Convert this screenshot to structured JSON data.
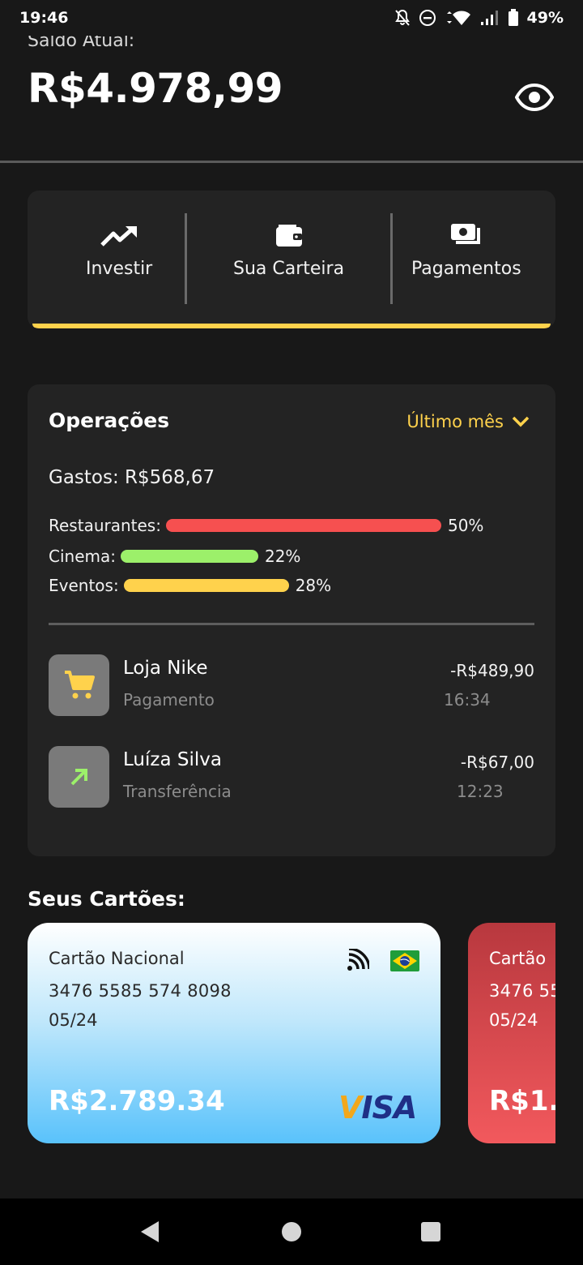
{
  "status_bar": {
    "time": "19:46",
    "battery": "49%"
  },
  "header": {
    "balance_label": "Saldo Atual:",
    "balance_value": "R$4.978,99"
  },
  "quick_actions": [
    {
      "label": "Investir",
      "icon": "trending-up-icon"
    },
    {
      "label": "Sua Carteira",
      "icon": "wallet-icon"
    },
    {
      "label": "Pagamentos",
      "icon": "payments-icon"
    }
  ],
  "operations": {
    "title": "Operações",
    "filter": "Último mês",
    "spent": "Gastos: R$568,67",
    "categories": [
      {
        "label": "Restaurantes:",
        "percent": 50,
        "percent_text": "50%",
        "color": "#f65050"
      },
      {
        "label": "Cinema:",
        "percent": 22,
        "percent_text": "22%",
        "color": "#9cf06a"
      },
      {
        "label": "Eventos:",
        "percent": 28,
        "percent_text": "28%",
        "color": "#ffd24c"
      }
    ],
    "transactions": [
      {
        "name": "Loja Nike",
        "type": "Pagamento",
        "amount": "-R$489,90",
        "time": "16:34",
        "icon": "shopping-cart-icon",
        "icon_color": "#ffd24c"
      },
      {
        "name": "Luíza Silva",
        "type": "Transferência",
        "amount": "-R$67,00",
        "time": "12:23",
        "icon": "arrow-up-right-icon",
        "icon_color": "#9cf06a"
      }
    ]
  },
  "cards_section": {
    "title": "Seus Cartões:",
    "cards": [
      {
        "name": "Cartão Nacional",
        "number": "3476 5585 574 8098",
        "expiry": "05/24",
        "balance": "R$2.789.34",
        "brand": "VISA"
      },
      {
        "name": "Cartão",
        "number": "3476 55",
        "expiry": "05/24",
        "balance": "R$1.2"
      }
    ]
  },
  "colors": {
    "accent": "#ffd24c",
    "background": "#181818",
    "card_bg": "#232323"
  }
}
